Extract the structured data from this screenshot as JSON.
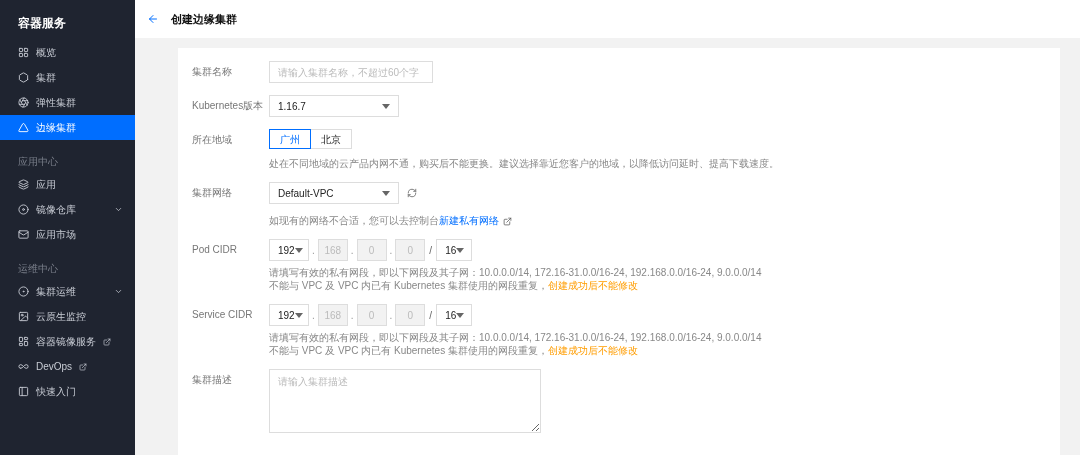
{
  "sidebar": {
    "title": "容器服务",
    "sections": [
      {
        "items": [
          {
            "label": "概览",
            "selected": false,
            "collapsible": false,
            "external": false
          },
          {
            "label": "集群",
            "selected": false,
            "collapsible": false,
            "external": false
          },
          {
            "label": "弹性集群",
            "selected": false,
            "collapsible": false,
            "external": false
          },
          {
            "label": "边缘集群",
            "selected": true,
            "collapsible": false,
            "external": false
          }
        ]
      },
      {
        "heading": "应用中心",
        "items": [
          {
            "label": "应用",
            "selected": false,
            "collapsible": false,
            "external": false
          },
          {
            "label": "镜像仓库",
            "selected": false,
            "collapsible": true,
            "external": false
          },
          {
            "label": "应用市场",
            "selected": false,
            "collapsible": false,
            "external": false
          }
        ]
      },
      {
        "heading": "运维中心",
        "items": [
          {
            "label": "集群运维",
            "selected": false,
            "collapsible": true,
            "external": false
          },
          {
            "label": "云原生监控",
            "selected": false,
            "collapsible": false,
            "external": false
          },
          {
            "label": "容器镜像服务",
            "selected": false,
            "collapsible": false,
            "external": true
          },
          {
            "label": "DevOps",
            "selected": false,
            "collapsible": false,
            "external": true
          },
          {
            "label": "快速入门",
            "selected": false,
            "collapsible": false,
            "external": false
          }
        ]
      }
    ]
  },
  "header": {
    "title": "创建边缘集群"
  },
  "form": [
    {
      "kind": "text",
      "label": "集群名称",
      "placeholder": "请输入集群名称，不超过60个字"
    },
    {
      "kind": "select",
      "label": "Kubernetes版本",
      "value": "1.16.7"
    },
    {
      "kind": "segmented",
      "label": "所在地域",
      "options": [
        {
          "label": "广州",
          "selected": true
        },
        {
          "label": "北京",
          "selected": false
        }
      ],
      "hint": [
        {
          "text": "处在不同地域的云产品内网不通，购买后不能更换。建议选择靠近您客户的地域，以降低访问延时、提高下载速度。",
          "kind": "plain"
        }
      ]
    },
    {
      "kind": "network",
      "label": "集群网络",
      "value": "Default-VPC",
      "hint": [
        {
          "text": "如现有的网络不合适，您可以去控制台",
          "kind": "plain"
        },
        {
          "text": "新建私有网络",
          "kind": "link"
        }
      ]
    },
    {
      "kind": "cidr",
      "label": "Pod CIDR",
      "first": "192",
      "octets": [
        "168",
        "0",
        "0"
      ],
      "dot": ".",
      "slash": "/",
      "mask": "16",
      "hint_lines": [
        [
          {
            "text": "请填写有效的私有网段，即以下网段及其子网：10.0.0.0/14, 172.16-31.0.0/16-24, 192.168.0.0/16-24, 9.0.0.0/14",
            "kind": "plain"
          }
        ],
        [
          {
            "text": "不能与 VPC 及 VPC 内已有 Kubernetes 集群使用的网段重复，",
            "kind": "plain"
          },
          {
            "text": "创建成功后不能修改",
            "kind": "warning"
          }
        ]
      ]
    },
    {
      "kind": "cidr",
      "label": "Service CIDR",
      "first": "192",
      "octets": [
        "168",
        "0",
        "0"
      ],
      "dot": ".",
      "slash": "/",
      "mask": "16",
      "hint_lines": [
        [
          {
            "text": "请填写有效的私有网段，即以下网段及其子网：10.0.0.0/14, 172.16-31.0.0/16-24, 192.168.0.0/16-24, 9.0.0.0/14",
            "kind": "plain"
          }
        ],
        [
          {
            "text": "不能与 VPC 及 VPC 内已有 Kubernetes 集群使用的网段重复，",
            "kind": "plain"
          },
          {
            "text": "创建成功后不能修改",
            "kind": "warning"
          }
        ]
      ]
    },
    {
      "kind": "textarea",
      "label": "集群描述",
      "placeholder": "请输入集群描述"
    }
  ]
}
